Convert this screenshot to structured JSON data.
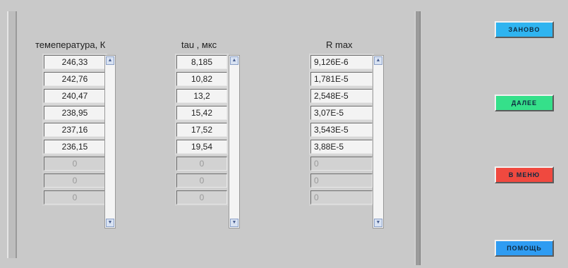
{
  "columns": [
    {
      "header": "темепература, К",
      "rows": [
        "246,33",
        "242,76",
        "240,47",
        "238,95",
        "237,16",
        "236,15",
        "0",
        "0",
        "0"
      ]
    },
    {
      "header": "tau , мкс",
      "rows": [
        "8,185",
        "10,82",
        "13,2",
        "15,42",
        "17,52",
        "19,54",
        "0",
        "0",
        "0"
      ]
    },
    {
      "header": "R max",
      "rows": [
        "9,126E-6",
        "1,781E-5",
        "2,548E-5",
        "3,07E-5",
        "3,543E-5",
        "3,88E-5",
        "0",
        "0",
        "0"
      ]
    }
  ],
  "buttons": {
    "restart": {
      "label": "ЗАНОВО",
      "color": "#2fb4f0"
    },
    "next": {
      "label": "ДАЛЕЕ",
      "color": "#35e08a"
    },
    "menu": {
      "label": "В МЕНЮ",
      "color": "#f0493f"
    },
    "help": {
      "label": "ПОМОЩЬ",
      "color": "#2f9cf2"
    }
  }
}
